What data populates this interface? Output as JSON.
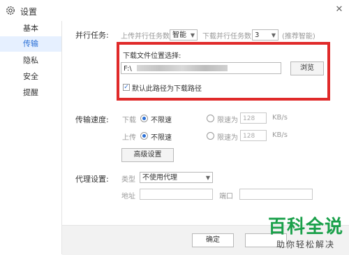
{
  "window": {
    "title": "设置",
    "close_glyph": "✕"
  },
  "sidebar": {
    "items": [
      {
        "label": "基本"
      },
      {
        "label": "传输"
      },
      {
        "label": "隐私"
      },
      {
        "label": "安全"
      },
      {
        "label": "提醒"
      }
    ],
    "active_index": 1
  },
  "parallel": {
    "section_label": "并行任务:",
    "upload_label": "上传并行任务数",
    "upload_value": "智能",
    "download_label": "下载并行任务数",
    "download_value": "3",
    "recommend_hint": "(推荐智能)"
  },
  "download_location": {
    "label": "下载文件位置选择:",
    "path_value": "F:\\",
    "browse_label": "浏览",
    "default_checkbox_label": "默认此路径为下载路径",
    "default_checked": true
  },
  "speed": {
    "section_label": "传输速度:",
    "download_label": "下载",
    "upload_label": "上传",
    "unlimited_label": "不限速",
    "limit_label": "限速为",
    "limit_value": "128",
    "unit": "KB/s",
    "advanced_button": "高级设置"
  },
  "proxy": {
    "section_label": "代理设置:",
    "type_label": "类型",
    "type_value": "不使用代理",
    "address_label": "地址",
    "port_label": "端口"
  },
  "footer": {
    "ok_label": "确定"
  },
  "watermark": {
    "logo": "百科全说",
    "sub": "助你轻松解决"
  },
  "colors": {
    "accent": "#2a6fd6",
    "highlight_border": "#e02a2a",
    "watermark_green": "#1aa04a"
  }
}
